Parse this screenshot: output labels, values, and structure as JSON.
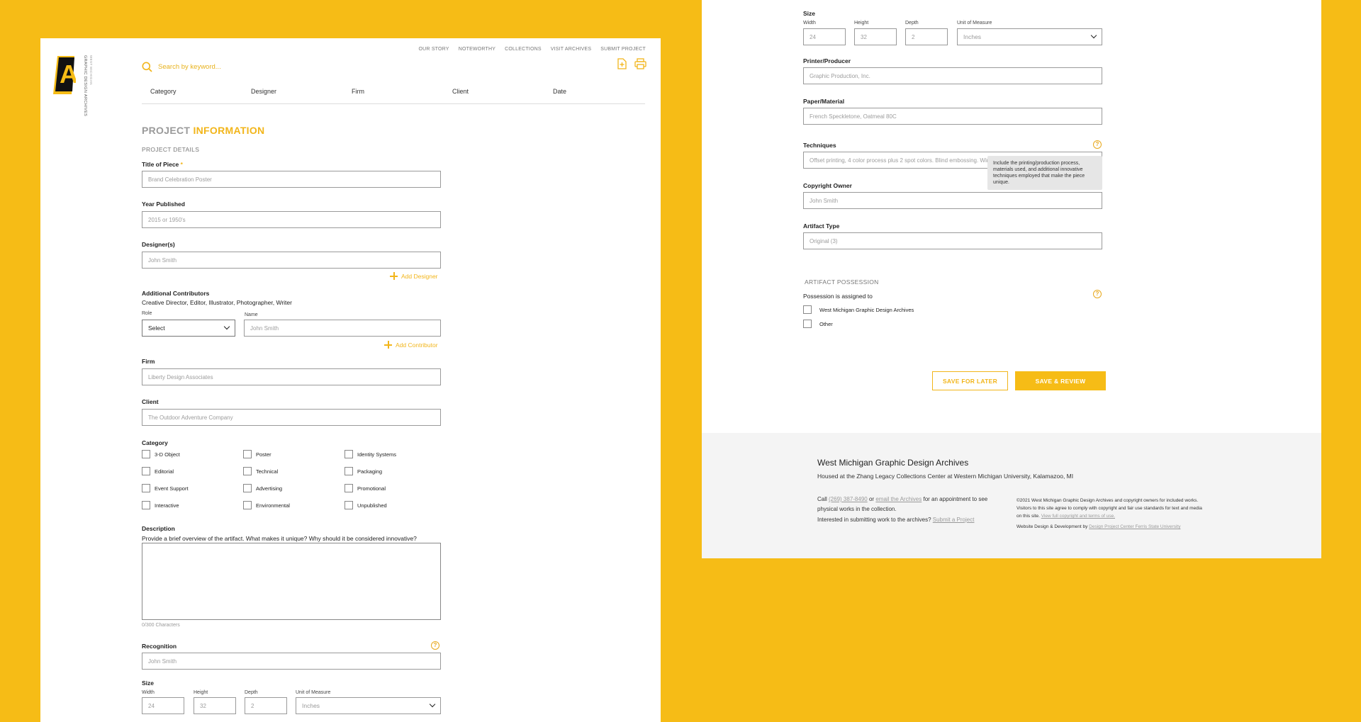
{
  "brand": {
    "logo_text": "GRAPHIC DESIGN ARCHIVES",
    "logo_sub": "WEST MICHIGAN"
  },
  "search": {
    "placeholder": "Search by keyword..."
  },
  "nav": [
    "OUR STORY",
    "NOTEWORTHY",
    "COLLECTIONS",
    "VISIT ARCHIVES",
    "SUBMIT PROJECT"
  ],
  "filters": [
    "Category",
    "Designer",
    "Firm",
    "Client",
    "Date"
  ],
  "page_title": {
    "part1": "PROJECT",
    "part2": "INFORMATION"
  },
  "project_details": {
    "section_label": "PROJECT DETAILS",
    "title_label": "Title of Piece",
    "title_required": "*",
    "title_value": "Brand Celebration Poster",
    "year_label": "Year Published",
    "year_value": "2015 or 1950's",
    "designers_label": "Designer(s)",
    "designers_value": "John Smith",
    "add_designer": "Add Designer",
    "contributors_label": "Additional Contributors",
    "contributors_sub": "Creative Director, Editor, Illustrator, Photographer, Writer",
    "role_label": "Role",
    "role_value": "Select",
    "name_label": "Name",
    "name_value": "John Smith",
    "add_contributor": "Add Contributor",
    "firm_label": "Firm",
    "firm_value": "Liberty Design Associates",
    "client_label": "Client",
    "client_value": "The Outdoor Adventure Company",
    "category_label": "Category",
    "categories": [
      "3-D Object",
      "Poster",
      "Identity Systems",
      "Editorial",
      "Technical",
      "Packaging",
      "Event Support",
      "Advertising",
      "Promotional",
      "Interactive",
      "Environmental",
      "Unpublished"
    ],
    "description_label": "Description",
    "description_sub": "Provide a brief overview of the artifact. What makes it unique? Why should it be considered innovative?",
    "char_count": "0/300 Characters",
    "recognition_label": "Recognition",
    "recognition_value": "John Smith"
  },
  "size": {
    "label": "Size",
    "width_label": "Width",
    "width_value": "24",
    "height_label": "Height",
    "height_value": "32",
    "depth_label": "Depth",
    "depth_value": "2",
    "unit_label": "Unit of Measure",
    "unit_value": "Inches"
  },
  "right": {
    "printer_label": "Printer/Producer",
    "printer_value": "Graphic Production, Inc.",
    "paper_label": "Paper/Material",
    "paper_value": "French Speckletone, Oatmeal 80C",
    "techniques_label": "Techniques",
    "techniques_value": "Offset printing, 4 color process plus 2 spot colors. Blind embossing. Wire-O b",
    "techniques_tooltip": "Include the printing/production process, materials used, and additional innovative techniques employed that make the piece unique.",
    "copyright_label": "Copyright Owner",
    "copyright_value": "John Smith",
    "artifact_type_label": "Artifact Type",
    "artifact_type_value": "Original (3)",
    "possession_section": "ARTIFACT POSSESSION",
    "possession_label": "Possession is assigned to",
    "possession_options": [
      "West Michigan Graphic Design Archives",
      "Other"
    ],
    "save_later": "SAVE FOR LATER",
    "save_review": "SAVE & REVIEW"
  },
  "footer": {
    "title": "West Michigan Graphic Design Archives",
    "subtitle": "Housed at the Zhang Legacy Collections Center at Western Michigan University, Kalamazoo, MI",
    "call_pre": "Call",
    "phone": "(269) 387-8490",
    "or": "or",
    "email_link": "email the Archives",
    "call_post": "for an appointment to see physical works in the collection.",
    "interested": "Interested in submitting work to the archives?",
    "submit_link": "Submit a Project",
    "copyright": "©2021 West Michigan Graphic Design Archives and copyright owners for included works. Visitors to this site agree to comply with copyright and fair use standards for text and media on this site.",
    "terms_link": "View full copyright and terms of use.",
    "credit_pre": "Website Design & Development by",
    "credit_link": "Design Project Center Ferris State University"
  },
  "colors": {
    "accent": "#f6bc16",
    "accent_text": "#f2b51a",
    "footer_bg": "#f4f4f4"
  }
}
